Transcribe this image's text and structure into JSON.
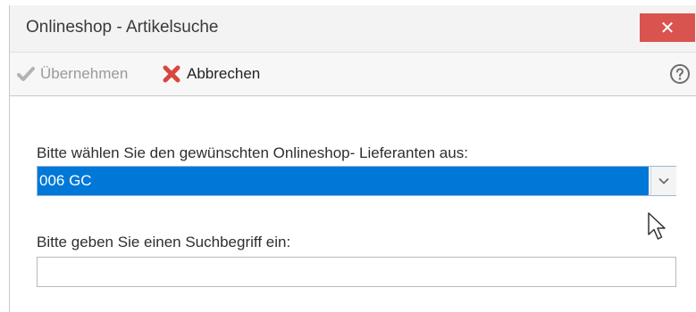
{
  "window": {
    "title": "Onlineshop - Artikelsuche",
    "close_icon": "close-icon",
    "accent_close": "#d9534f"
  },
  "toolbar": {
    "accept_label": "Übernehmen",
    "accept_icon": "checkmark-icon",
    "cancel_label": "Abbrechen",
    "cancel_icon": "x-cross-icon",
    "help_icon": "help-icon"
  },
  "form": {
    "supplier_label": "Bitte wählen Sie den gewünschten Onlineshop- Lieferanten aus:",
    "supplier_selected": "006 GC",
    "selection_color": "#0078d7",
    "search_label": "Bitte geben Sie einen Suchbegriff ein:",
    "search_value": ""
  }
}
